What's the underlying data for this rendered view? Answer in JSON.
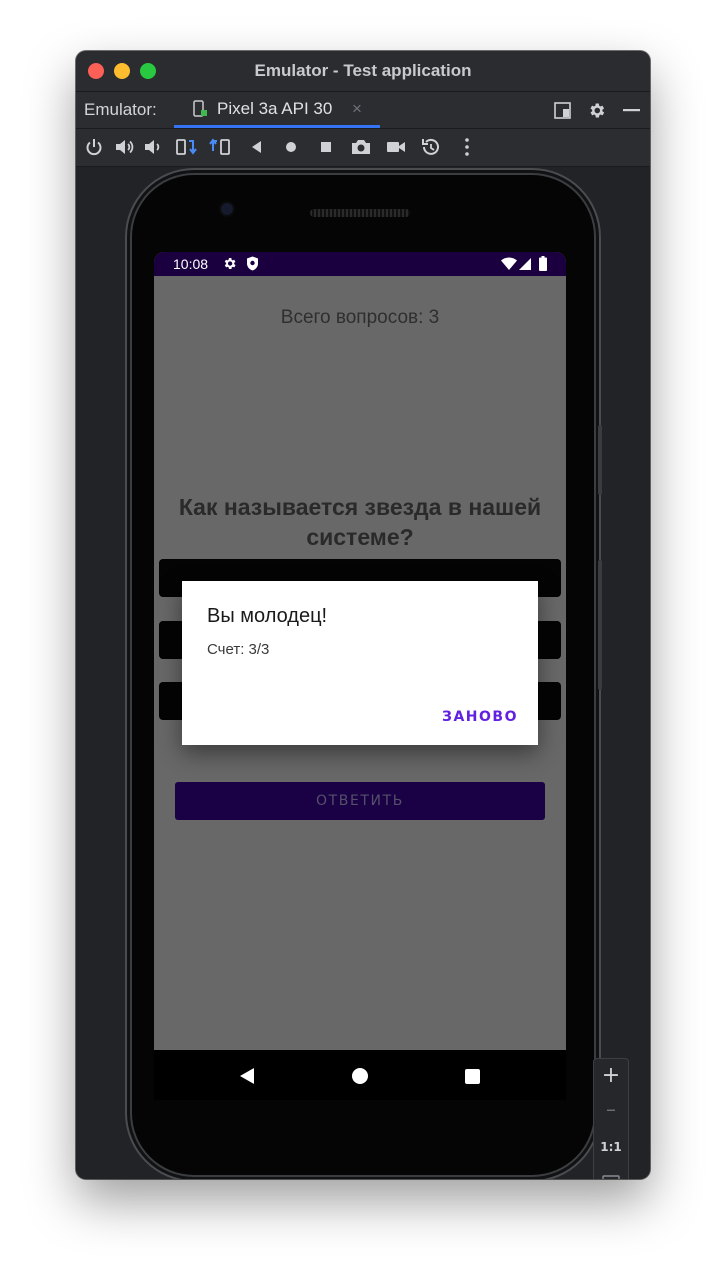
{
  "window": {
    "title": "Emulator - Test application"
  },
  "tabbar": {
    "caption": "Emulator:",
    "tab_label": "Pixel 3a API 30",
    "tab_close": "×"
  },
  "toolbar": {
    "buttons": [
      "power-icon",
      "volume-up-icon",
      "volume-down-icon",
      "rotate-left-icon",
      "rotate-right-icon",
      "back-icon",
      "home-icon",
      "overview-icon",
      "screenshot-icon",
      "screen-record-icon",
      "snapshot-icon",
      "more-icon"
    ]
  },
  "status_bar": {
    "time": "10:08"
  },
  "app": {
    "total_questions": "Всего вопросов: 3",
    "question": "Как называется звезда в нашей системе?",
    "submit_label": "ОТВЕТИТЬ"
  },
  "dialog": {
    "title": "Вы молодец!",
    "message": "Счет: 3/3",
    "button": "ЗАНОВО"
  },
  "zoom": {
    "plus": "+",
    "minus": "–",
    "actual": "1:1"
  },
  "colors": {
    "status_bar": "#1b0040",
    "primary_button": "#1a0044",
    "dialog_accent": "#6220e0",
    "scrim_background": "#686868"
  }
}
